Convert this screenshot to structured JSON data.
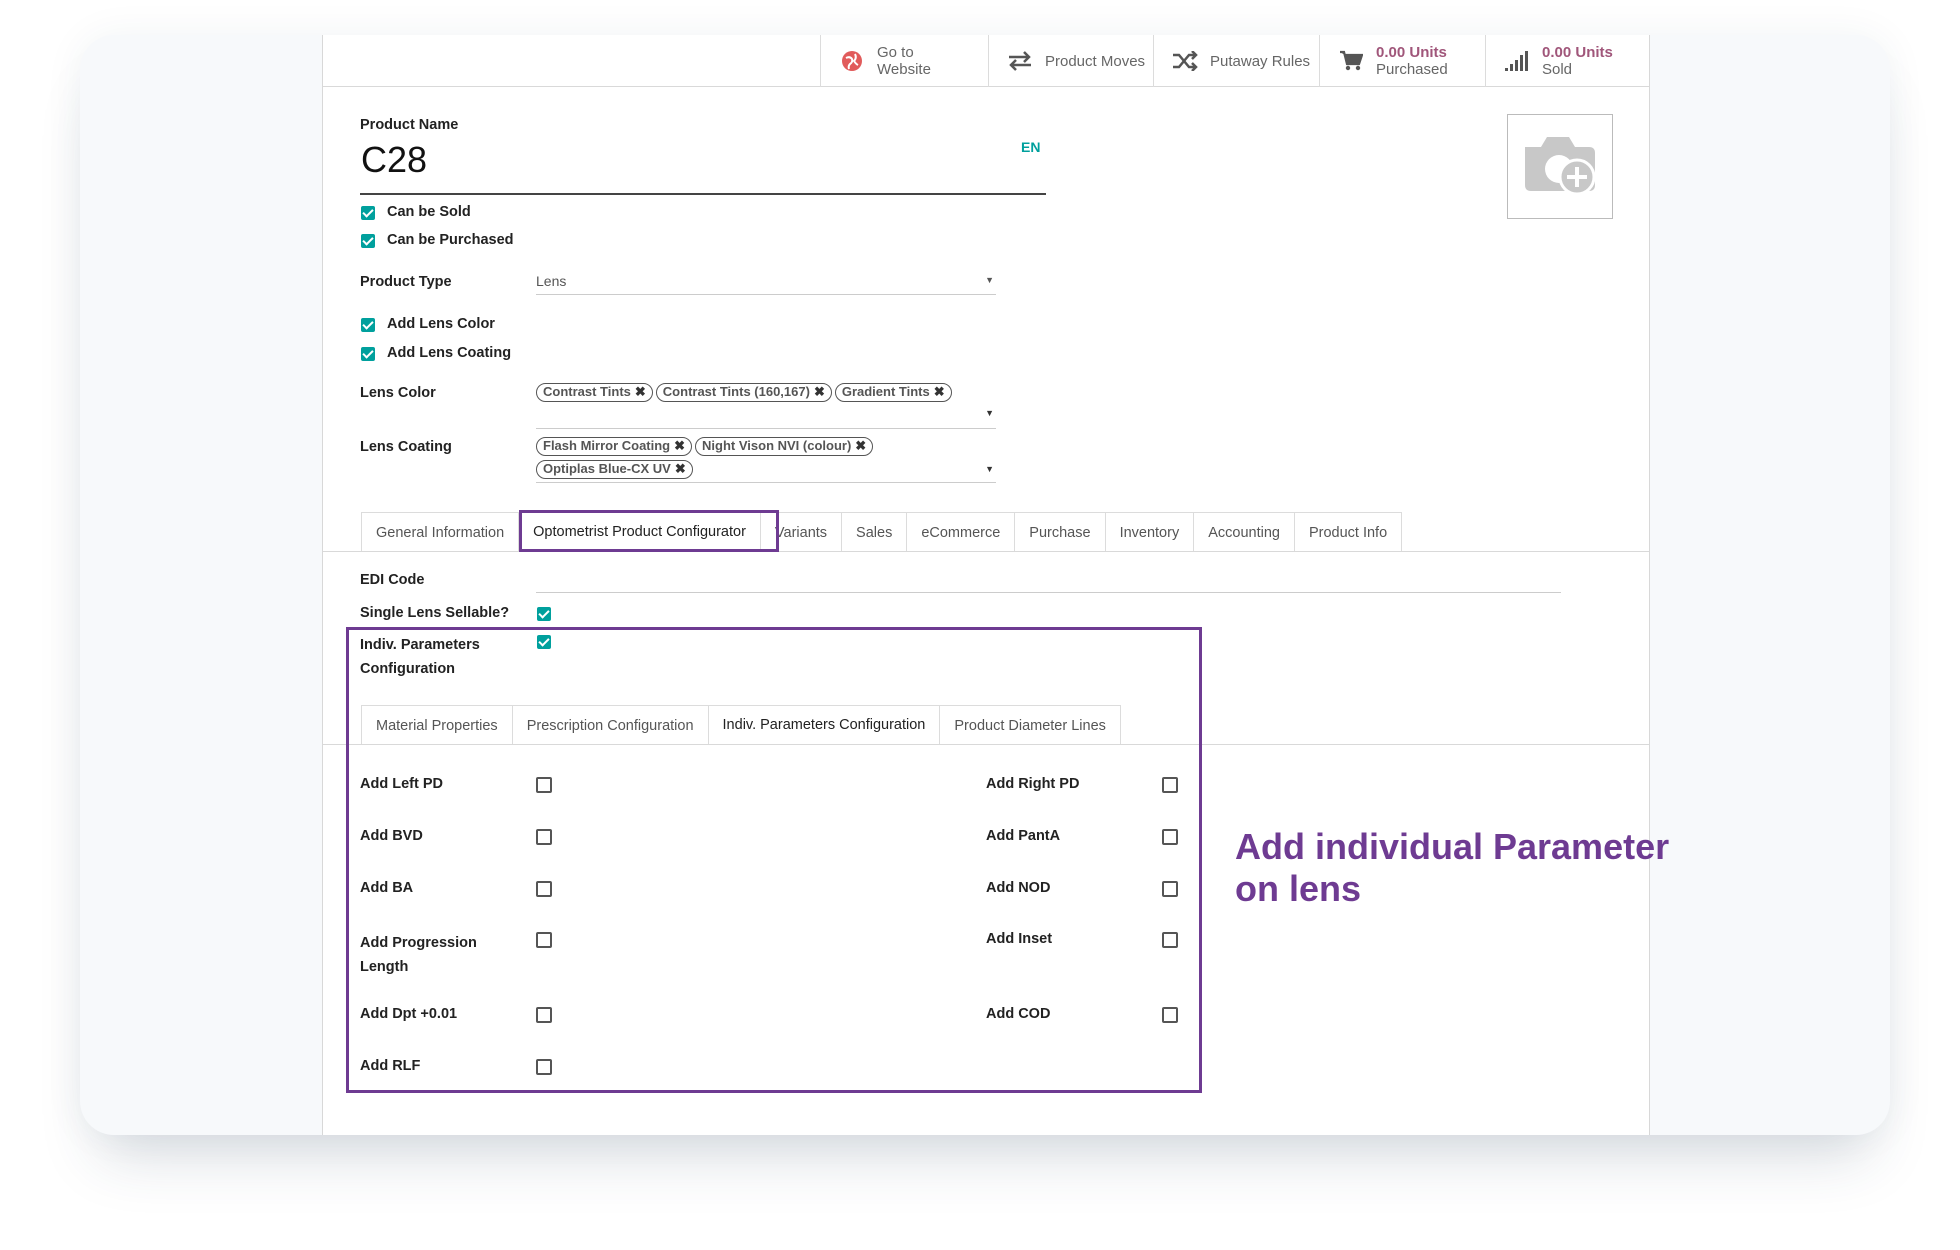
{
  "colors": {
    "accent": "#00a09d",
    "highlight": "#6e3b92",
    "stat": "#a0567a"
  },
  "smart_buttons": [
    {
      "icon": "globe-icon",
      "line1": "Go to",
      "line2": "Website"
    },
    {
      "icon": "exchange-arrows-icon",
      "label": "Product Moves"
    },
    {
      "icon": "shuffle-icon",
      "label": "Putaway Rules"
    },
    {
      "icon": "cart-icon",
      "value": "0.00 Units",
      "line2": "Purchased"
    },
    {
      "icon": "bar-chart-icon",
      "value": "0.00 Units",
      "line2": "Sold"
    }
  ],
  "product": {
    "name_label": "Product Name",
    "name": "C28",
    "lang": "EN",
    "can_be_sold": "Can be Sold",
    "can_be_purchased": "Can be Purchased",
    "type_label": "Product Type",
    "type_value": "Lens",
    "add_lens_color": "Add Lens Color",
    "add_lens_coating": "Add Lens Coating",
    "lens_color_label": "Lens Color",
    "lens_color_tags": [
      "Contrast Tints",
      "Contrast Tints (160,167)",
      "Gradient Tints"
    ],
    "lens_coating_label": "Lens Coating",
    "lens_coating_tags_row1": [
      "Flash Mirror Coating",
      "Night Vison NVI (colour)"
    ],
    "lens_coating_tags_row2": [
      "Optiplas Blue-CX UV"
    ]
  },
  "main_tabs": [
    "General Information",
    "Optometrist Product Configurator",
    "Variants",
    "Sales",
    "eCommerce",
    "Purchase",
    "Inventory",
    "Accounting",
    "Product Info"
  ],
  "configurator": {
    "edi_label": "EDI Code",
    "single_lens_label": "Single Lens Sellable?",
    "indiv_label_1": "Indiv. Parameters",
    "indiv_label_2": "Configuration"
  },
  "sub_tabs": [
    "Material Properties",
    "Prescription Configuration",
    "Indiv. Parameters Configuration",
    "Product Diameter Lines"
  ],
  "params_left": [
    "Add Left PD",
    "Add BVD",
    "Add BA",
    "Add Progression",
    "Add Dpt +0.01",
    "Add RLF"
  ],
  "params_left_extra": "Length",
  "params_right": [
    "Add Right PD",
    "Add PantA",
    "Add NOD",
    "Add Inset",
    "Add COD"
  ],
  "callout": {
    "line1": "Add individual Parameter",
    "line2": "on lens"
  }
}
